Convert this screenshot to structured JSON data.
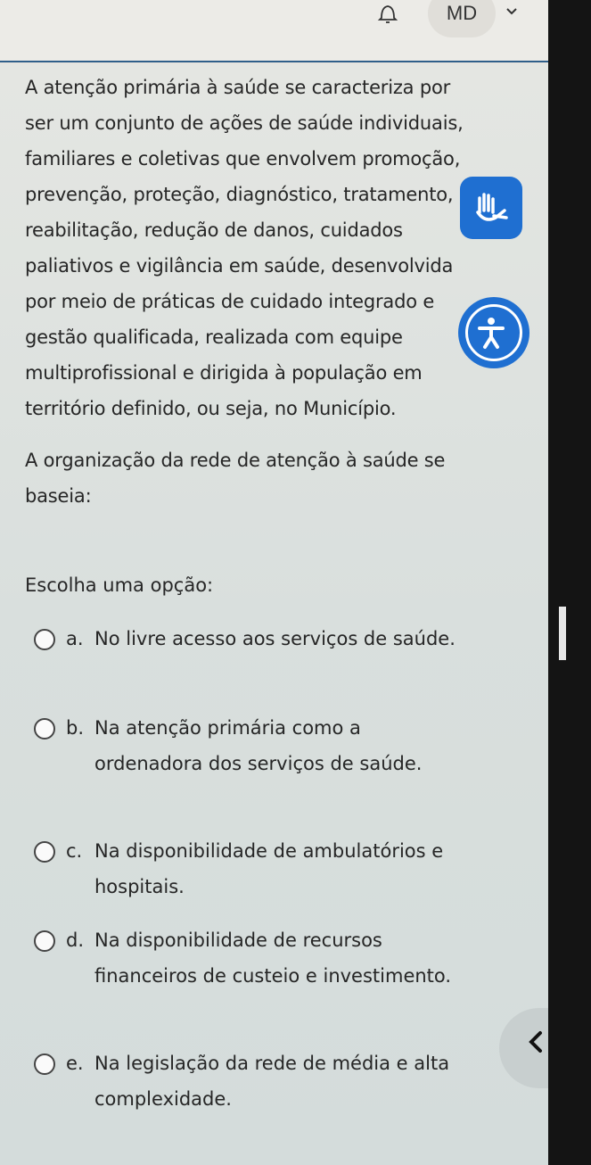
{
  "header": {
    "avatar_initials": "MD",
    "icons": [
      "bell-icon",
      "chevron-down-icon"
    ]
  },
  "question": {
    "paragraph_1": "A atenção primária à saúde se caracteriza por ser um conjunto de ações de saúde individuais, familiares e coletivas que envolvem promoção, prevenção, proteção, diagnóstico, tratamento, reabilitação, redução de danos, cuidados paliativos e vigilância em saúde, desenvolvida por meio de práticas de cuidado integrado e gestão qualificada, realizada com equipe multiprofissional e dirigida à população em território definido, ou seja, no Município.",
    "paragraph_2": "A organização da rede de atenção à saúde se baseia:"
  },
  "prompt": "Escolha uma opção:",
  "options": [
    {
      "letter": "a.",
      "text": "No livre acesso aos serviços de saúde."
    },
    {
      "letter": "b.",
      "text": "Na atenção primária como a ordenadora dos serviços de saúde."
    },
    {
      "letter": "c.",
      "text": "Na disponibilidade de ambulatórios e hospitais."
    },
    {
      "letter": "d.",
      "text": "Na disponibilidade de recursos financeiros de custeio e investimento."
    },
    {
      "letter": "e.",
      "text": "Na legislação da rede de média e alta complexidade."
    }
  ],
  "floating_buttons": [
    "sign-language-icon",
    "accessibility-icon",
    "chevron-left-icon"
  ],
  "colors": {
    "accent": "#1f6fd1",
    "header_border": "#2f5f8a",
    "text": "#262626"
  }
}
